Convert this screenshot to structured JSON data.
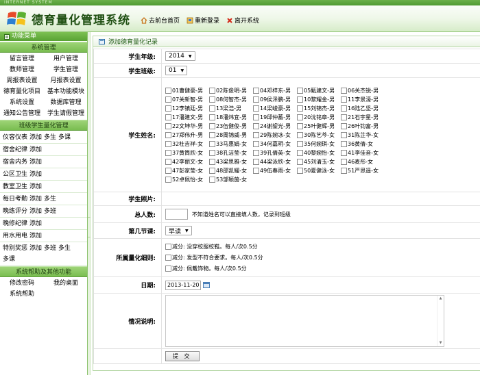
{
  "header": {
    "strip_text": "INTERNET SYSTEM",
    "title": "德育量化管理系统",
    "links": [
      {
        "label": "去前台首页",
        "icon": "home-icon"
      },
      {
        "label": "重新登录",
        "icon": "relogin-icon"
      },
      {
        "label": "离开系统",
        "icon": "close-icon"
      }
    ]
  },
  "sidebar": {
    "menu_title": "功能菜单",
    "sections": [
      {
        "title": "系统管理"
      },
      {
        "title": "班级学生量化管理"
      },
      {
        "title": "系统帮助及其他功能"
      }
    ],
    "system_items": [
      "留言管理",
      "用户管理",
      "教师管理",
      "学生管理",
      "周报表设置",
      "月报表设置",
      "德育量化项目",
      "基本功能模块",
      "系统设置",
      "数据库管理",
      "通知公告管理",
      "学生请假管理"
    ],
    "class_items": [
      {
        "name": "仪容仪表",
        "actions": [
          "添加",
          "多生",
          "多课"
        ]
      },
      {
        "name": "宿舍纪律",
        "actions": [
          "添加"
        ]
      },
      {
        "name": "宿舍内务",
        "actions": [
          "添加"
        ]
      },
      {
        "name": "公区卫生",
        "actions": [
          "添加"
        ]
      },
      {
        "name": "教室卫生",
        "actions": [
          "添加"
        ]
      },
      {
        "name": "每日考勤",
        "actions": [
          "添加",
          "多生"
        ]
      },
      {
        "name": "晚练评分",
        "actions": [
          "添加",
          "多班"
        ]
      },
      {
        "name": "晚修纪律",
        "actions": [
          "添加"
        ]
      },
      {
        "name": "用水用电",
        "actions": [
          "添加"
        ]
      },
      {
        "name": "特别奖惩",
        "actions": [
          "添加",
          "多班",
          "多生",
          "多课"
        ]
      }
    ],
    "help_items": [
      "修改密码",
      "我的桌面",
      "系统帮助"
    ]
  },
  "panel": {
    "title": "添加德育量化记录"
  },
  "form": {
    "grade_label": "学生年级:",
    "grade_value": "2014",
    "class_label": "学生班级:",
    "class_value": "01",
    "name_label": "学生姓名:",
    "students": [
      "01曹健豪-男",
      "02陈俊明-男",
      "04邓梓东-男",
      "05甄建文-男",
      "06关杰锐-男",
      "07关新智-男",
      "08何智杰-男",
      "09侯泽鹏-男",
      "10黎耀金-男",
      "11李景濠-男",
      "12李镇廷-男",
      "13梁浩-男",
      "14梁峻豪-男",
      "15刘锦杰-男",
      "16陆乙坚-男",
      "17潘建文-男",
      "18潘炜宜-男",
      "19邱仲蓄-男",
      "20沈铭章-男",
      "21石宇星-男",
      "22文坤华-男",
      "23伍健俊-男",
      "24谢鋆光-男",
      "25叶健辉-男",
      "26叶钧富-男",
      "27郑伟升-男",
      "28周锦威-男",
      "29陈婉冰-女",
      "30陈艺芩-女",
      "31陈芷华-女",
      "32杜吉祥-女",
      "33马惠娟-女",
      "34何嘉玥-女",
      "35何婉琪-女",
      "36黄倩-女",
      "37黄筒欣-女",
      "38孔洁莹-女",
      "39孔倩英-女",
      "40黎婉怡-女",
      "41李佳音-女",
      "42李丽文-女",
      "43梁思雅-女",
      "44梁泳欣-女",
      "45刘清玉-女",
      "46麦彤-女",
      "47彭家莹-女",
      "48邵凯耀-女",
      "49伍春雨-女",
      "50夏健泳-女",
      "51严思遥-女",
      "52卓佩怡-女",
      "53邹颖茵-女"
    ],
    "photo_label": "学生照片:",
    "count_label": "总人数:",
    "count_hint": "不知道姓名可以直接填人数，记录到班级",
    "period_label": "第几节课:",
    "period_value": "早读",
    "rules_label": "所属量化细则:",
    "rules": [
      "减分: 没穿校服校鞋。每人/次0.5分",
      "减分: 发型不符合要求。每人/次0.5分",
      "减分: 佩戴饰物。每人/次0.5分"
    ],
    "date_label": "日期:",
    "date_value": "2013-11-20",
    "desc_label": "情况说明:",
    "submit_label": "提 交"
  }
}
